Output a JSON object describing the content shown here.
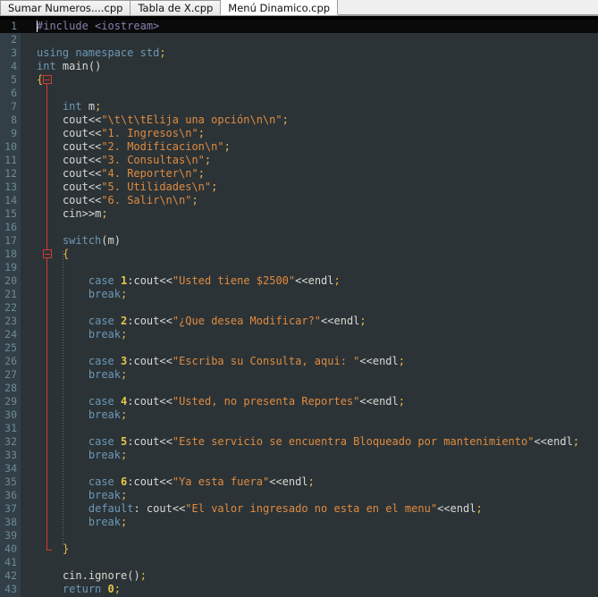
{
  "window": {
    "type": "code-editor",
    "theme": "dark",
    "background": "#2b3337",
    "gutter_background": "#323f47",
    "gutter_text": "#6f8a94",
    "current_line_background": "#0a0a0a",
    "fold_marker_color": "#d43a2f"
  },
  "tabs": [
    {
      "label": "Sumar Numeros....cpp",
      "active": false
    },
    {
      "label": "Tabla de X.cpp",
      "active": false
    },
    {
      "label": "Menú Dinamico.cpp",
      "active": true
    }
  ],
  "colors": {
    "keyword": "#6d98b5",
    "preprocessor": "#8a7fb0",
    "string": "#e08b3e",
    "number": "#e8c547",
    "punctuation": "#e8b84b",
    "identifier": "#d8d8d2"
  },
  "editor": {
    "language": "cpp",
    "caret_line": 1,
    "fold_markers": [
      {
        "line": 5,
        "state": "expanded"
      },
      {
        "line": 18,
        "state": "expanded"
      }
    ],
    "fold_line_from": 5,
    "fold_line_to": 40,
    "first_visible_line": 1,
    "last_visible_line": 43,
    "lines": [
      {
        "n": 1,
        "text": "#include <iostream>"
      },
      {
        "n": 2,
        "text": ""
      },
      {
        "n": 3,
        "text": "using namespace std;"
      },
      {
        "n": 4,
        "text": "int main()"
      },
      {
        "n": 5,
        "text": "{"
      },
      {
        "n": 6,
        "text": ""
      },
      {
        "n": 7,
        "text": "    int m;"
      },
      {
        "n": 8,
        "text": "    cout<<\"\\t\\t\\tElija una opción\\n\\n\";"
      },
      {
        "n": 9,
        "text": "    cout<<\"1. Ingresos\\n\";"
      },
      {
        "n": 10,
        "text": "    cout<<\"2. Modificacion\\n\";"
      },
      {
        "n": 11,
        "text": "    cout<<\"3. Consultas\\n\";"
      },
      {
        "n": 12,
        "text": "    cout<<\"4. Reporter\\n\";"
      },
      {
        "n": 13,
        "text": "    cout<<\"5. Utilidades\\n\";"
      },
      {
        "n": 14,
        "text": "    cout<<\"6. Salir\\n\\n\";"
      },
      {
        "n": 15,
        "text": "    cin>>m;"
      },
      {
        "n": 16,
        "text": ""
      },
      {
        "n": 17,
        "text": "    switch(m)"
      },
      {
        "n": 18,
        "text": "    {"
      },
      {
        "n": 19,
        "text": ""
      },
      {
        "n": 20,
        "text": "        case 1:cout<<\"Usted tiene $2500\"<<endl;"
      },
      {
        "n": 21,
        "text": "        break;"
      },
      {
        "n": 22,
        "text": ""
      },
      {
        "n": 23,
        "text": "        case 2:cout<<\"¿Que desea Modificar?\"<<endl;"
      },
      {
        "n": 24,
        "text": "        break;"
      },
      {
        "n": 25,
        "text": ""
      },
      {
        "n": 26,
        "text": "        case 3:cout<<\"Escriba su Consulta, aqui: \"<<endl;"
      },
      {
        "n": 27,
        "text": "        break;"
      },
      {
        "n": 28,
        "text": ""
      },
      {
        "n": 29,
        "text": "        case 4:cout<<\"Usted, no presenta Reportes\"<<endl;"
      },
      {
        "n": 30,
        "text": "        break;"
      },
      {
        "n": 31,
        "text": ""
      },
      {
        "n": 32,
        "text": "        case 5:cout<<\"Este servicio se encuentra Bloqueado por mantenimiento\"<<endl;"
      },
      {
        "n": 33,
        "text": "        break;"
      },
      {
        "n": 34,
        "text": ""
      },
      {
        "n": 35,
        "text": "        case 6:cout<<\"Ya esta fuera\"<<endl;"
      },
      {
        "n": 36,
        "text": "        break;"
      },
      {
        "n": 37,
        "text": "        default: cout<<\"El valor ingresado no esta en el menu\"<<endl;"
      },
      {
        "n": 38,
        "text": "        break;"
      },
      {
        "n": 39,
        "text": ""
      },
      {
        "n": 40,
        "text": "    }"
      },
      {
        "n": 41,
        "text": ""
      },
      {
        "n": 42,
        "text": "    cin.ignore();"
      },
      {
        "n": 43,
        "text": "    return 0;"
      }
    ]
  }
}
